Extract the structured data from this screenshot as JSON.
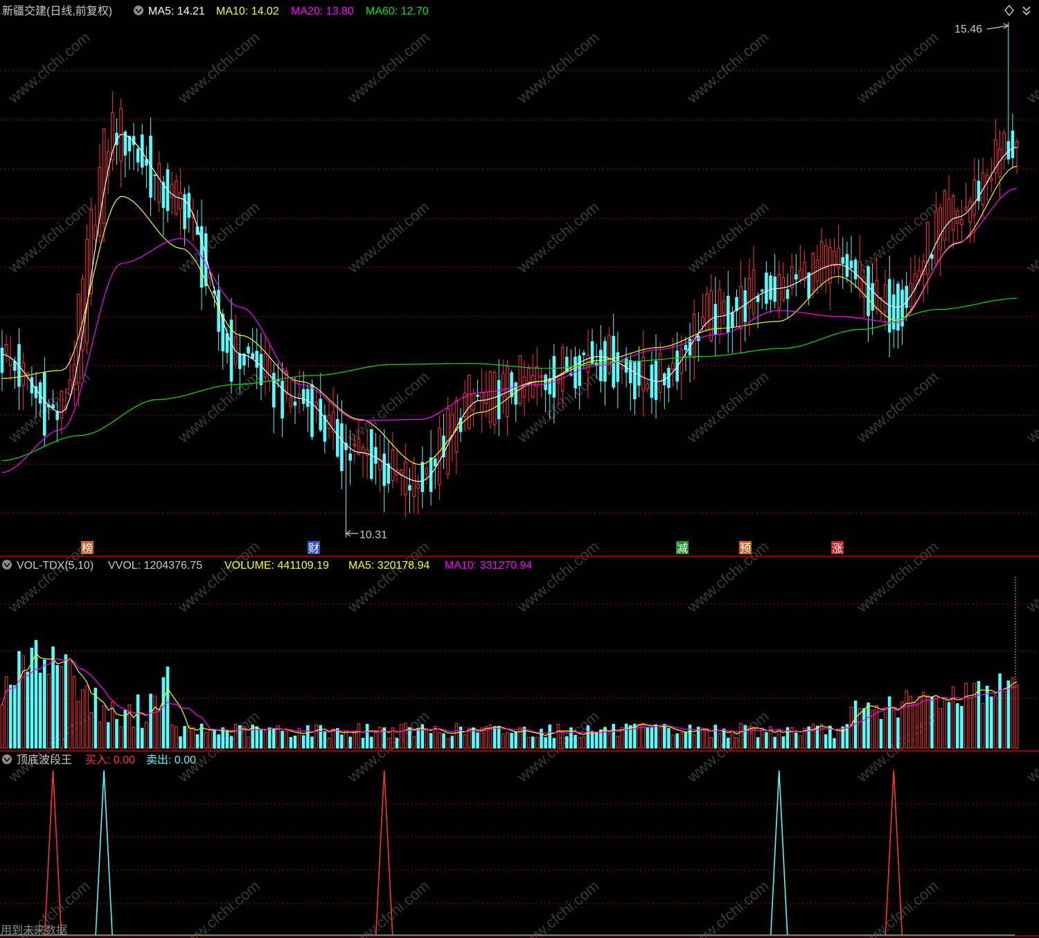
{
  "colors": {
    "background": "#000000",
    "up": "#ff3232",
    "down": "#54fcfc",
    "ma5": "#ffffff",
    "ma10": "#ffff00",
    "ma20": "#ff00ff",
    "ma60": "#00e600",
    "grid": "#b40000",
    "divider": "#c80000",
    "label_grey": "#c8c8c8"
  },
  "main": {
    "title": "新疆交建(日线,前复权)",
    "ma5_label": "MA5: 14.21",
    "ma10_label": "MA10: 14.02",
    "ma20_label": "MA20: 13.80",
    "ma60_label": "MA60: 12.70",
    "high_label": "15.46",
    "low_label": "10.31"
  },
  "events": [
    {
      "label": "榜",
      "color": "#c86428"
    },
    {
      "label": "财",
      "color": "#3250c8"
    },
    {
      "label": "减",
      "color": "#1e9628"
    },
    {
      "label": "预",
      "color": "#c86428"
    },
    {
      "label": "涨",
      "color": "#c81e1e"
    }
  ],
  "volume_panel": {
    "title": "VOL-TDX(5,10)",
    "vvol_label": "VVOL: 1204376.75",
    "volume_label": "VOLUME: 441109.19",
    "ma5_label": "MA5: 320178.94",
    "ma10_label": "MA10: 331270.94"
  },
  "indicator_panel": {
    "title": "顶底波段王",
    "buy_label": "买入: 0.00",
    "sell_label": "卖出: 0.00",
    "footer": "用到未来数据"
  },
  "watermark_text": "www.cfchi.com",
  "chart_data": [
    {
      "type": "candlestick",
      "title": "新疆交建(日线,前复权)",
      "y_range": [
        10.31,
        15.46
      ],
      "max_high": 15.46,
      "min_low": 10.31,
      "ma_latest": {
        "MA5": 14.21,
        "MA10": 14.02,
        "MA20": 13.8,
        "MA60": 12.7
      },
      "series": [
        {
          "name": "MA5",
          "color": "#ffffff",
          "anchors": [
            12.14,
            11.56,
            14.34,
            13.7,
            12.14,
            11.7,
            11.16,
            10.87,
            11.68,
            11.87,
            12.12,
            11.87,
            12.52,
            12.8,
            13.04,
            12.61,
            13.51,
            14.21
          ]
        },
        {
          "name": "MA10",
          "color": "#ffff00",
          "anchors": [
            11.9,
            11.98,
            13.72,
            13.2,
            12.33,
            11.87,
            11.49,
            11.04,
            11.56,
            11.87,
            12.08,
            12.21,
            12.4,
            12.47,
            12.92,
            12.48,
            13.25,
            14.02
          ]
        },
        {
          "name": "MA20",
          "color": "#ff00ff",
          "anchors": [
            10.96,
            11.39,
            13.05,
            13.3,
            12.61,
            11.84,
            11.48,
            11.49,
            11.76,
            11.84,
            12.03,
            12.19,
            12.34,
            12.58,
            12.52,
            12.46,
            13.26,
            13.8
          ]
        },
        {
          "name": "MA60",
          "color": "#00e600",
          "anchors": [
            11.08,
            11.33,
            11.69,
            11.84,
            11.93,
            12.04,
            12.05,
            12.0,
            12.07,
            12.12,
            12.2,
            12.39,
            12.59,
            12.7
          ]
        }
      ]
    },
    {
      "type": "bar",
      "title": "VOL-TDX(5,10)",
      "values_latest": {
        "VVOL": 1204376.75,
        "VOLUME": 441109.19,
        "MA5": 320178.94,
        "MA10": 331270.94
      },
      "series": [
        {
          "name": "MA5",
          "color": "#ffff00"
        },
        {
          "name": "MA10",
          "color": "#ff00ff"
        }
      ]
    },
    {
      "type": "line",
      "title": "顶底波段王",
      "series": [
        {
          "name": "买入",
          "color": "#ff3232",
          "latest": 0.0,
          "signal_bars": [
            12,
            90,
            210
          ]
        },
        {
          "name": "卖出",
          "color": "#54fcfc",
          "latest": 0.0,
          "signal_bars": [
            24,
            183
          ]
        }
      ]
    }
  ]
}
